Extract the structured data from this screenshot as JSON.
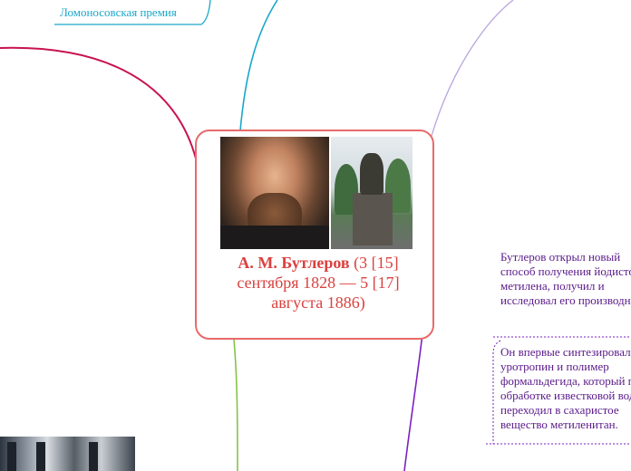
{
  "top_branch_label": "Ломоносовская премия",
  "central": {
    "name": "А. М. Бутлеров",
    "dates": "(3 [15] сентября 1828 — 5 [17] августа 1886)",
    "portrait_label": "portrait",
    "statue_label": "monument"
  },
  "topics": [
    {
      "text": "Бутлеров открыл новый способ получения йодистого метилена, получил и исследовал его производные."
    },
    {
      "text": "Он впервые синтезировал уротропин и полимер формальдегида, который при обработке известковой водой переходил в сахаристое вещество метиленитан."
    }
  ],
  "colors": {
    "crimson": "#c8134f",
    "teal": "#1aa7c9",
    "lavender": "#b9a6de",
    "green": "#86c24a",
    "purple": "#7a22c2",
    "central_border": "#e86a6a",
    "central_text": "#d9413f"
  }
}
